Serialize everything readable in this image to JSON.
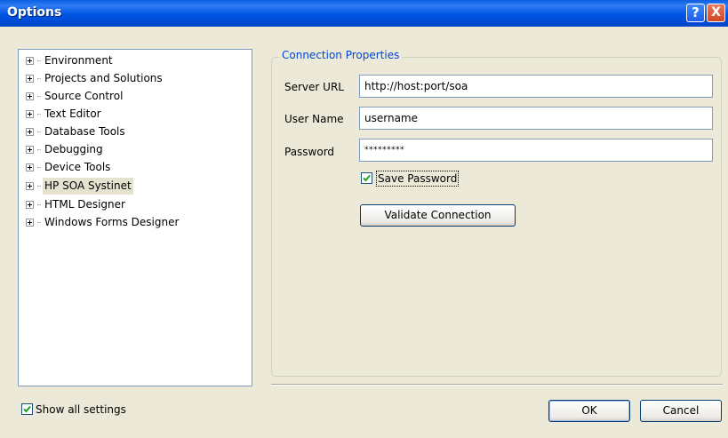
{
  "window": {
    "title": "Options"
  },
  "titlebar": {
    "help_label": "?",
    "close_label": "X"
  },
  "tree": {
    "items": [
      {
        "label": "Environment"
      },
      {
        "label": "Projects and Solutions"
      },
      {
        "label": "Source Control"
      },
      {
        "label": "Text Editor"
      },
      {
        "label": "Database Tools"
      },
      {
        "label": "Debugging"
      },
      {
        "label": "Device Tools"
      },
      {
        "label": "HP SOA Systinet"
      },
      {
        "label": "HTML Designer"
      },
      {
        "label": "Windows Forms Designer"
      }
    ],
    "selected_index": 7
  },
  "connection": {
    "group_title": "Connection Properties",
    "server_url_label": "Server URL",
    "server_url_value": "http://host:port/soa",
    "user_name_label": "User Name",
    "user_name_value": "username",
    "password_label": "Password",
    "password_value": "*********",
    "save_password_label": "Save Password",
    "save_password_checked": true,
    "validate_label": "Validate Connection"
  },
  "footer": {
    "show_all_label": "Show all settings",
    "show_all_checked": true,
    "ok_label": "OK",
    "cancel_label": "Cancel"
  }
}
